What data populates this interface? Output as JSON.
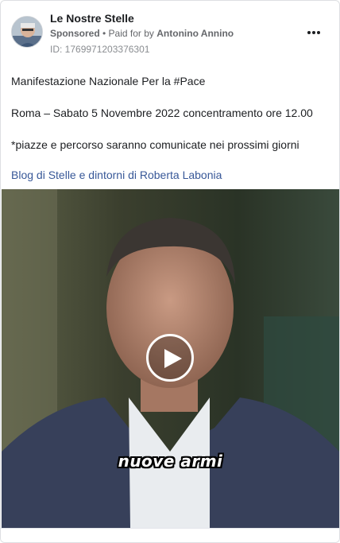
{
  "post": {
    "page_name": "Le Nostre Stelle",
    "sponsored_label": "Sponsored",
    "separator": " • ",
    "paid_for_prefix": "Paid for by ",
    "payer": "Antonino Annino",
    "ad_id": "ID: 1769971203376301",
    "more_icon": "ellipsis-icon",
    "lines": [
      "Manifestazione Nazionale Per la #Pace",
      "Roma – Sabato 5 Novembre 2022 concentramento ore 12.00",
      "*piazze e percorso saranno comunicate nei prossimi giorni"
    ],
    "link_text": "Blog di Stelle e dintorni di Roberta Labonia"
  },
  "video": {
    "caption": "nuove armi",
    "play_icon": "play-icon"
  },
  "colors": {
    "link": "#385898",
    "secondary_text": "#65676b",
    "border": "#dddfe2"
  }
}
